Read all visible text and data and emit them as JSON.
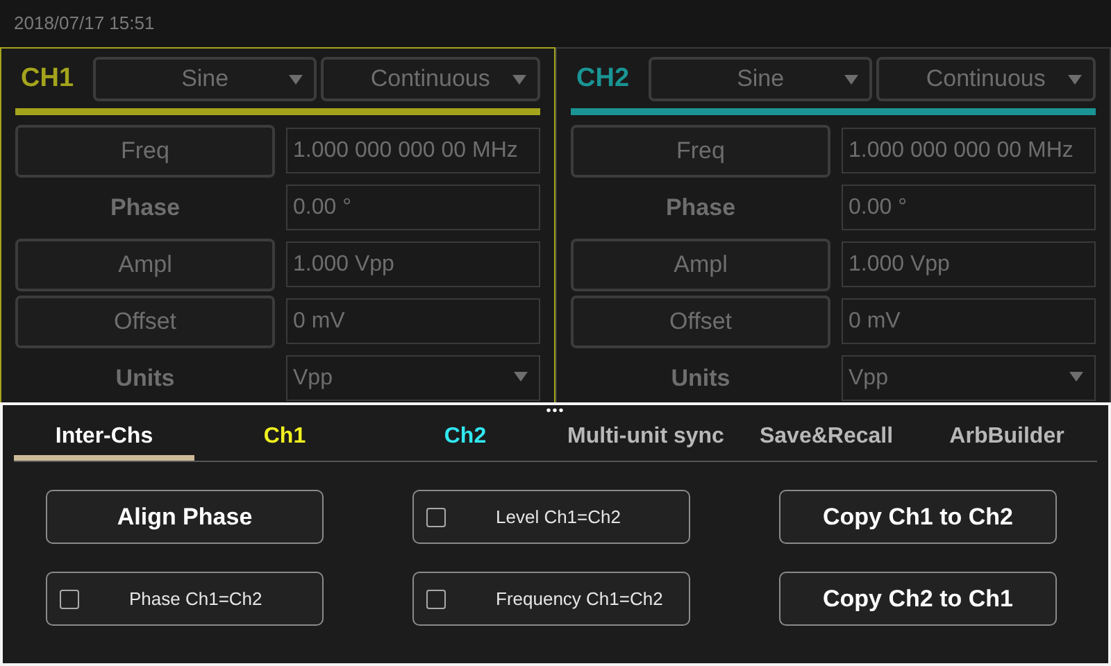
{
  "status_bar": {
    "datetime": "2018/07/17 15:51"
  },
  "channels": [
    {
      "label": "CH1",
      "color": "#a4a41c",
      "selected": true,
      "waveform": "Sine",
      "mode": "Continuous",
      "params": [
        {
          "kind": "button",
          "label": "Freq",
          "value": "1.000 000 000 00 MHz"
        },
        {
          "kind": "label",
          "label": "Phase",
          "value": "0.00 °"
        },
        {
          "kind": "button",
          "label": "Ampl",
          "value": "1.000 Vpp"
        },
        {
          "kind": "button",
          "label": "Offset",
          "value": "0 mV"
        }
      ],
      "units": {
        "label": "Units",
        "value": "Vpp"
      }
    },
    {
      "label": "CH2",
      "color": "#1a9494",
      "selected": false,
      "waveform": "Sine",
      "mode": "Continuous",
      "params": [
        {
          "kind": "button",
          "label": "Freq",
          "value": "1.000 000 000 00 MHz"
        },
        {
          "kind": "label",
          "label": "Phase",
          "value": "0.00 °"
        },
        {
          "kind": "button",
          "label": "Ampl",
          "value": "1.000 Vpp"
        },
        {
          "kind": "button",
          "label": "Offset",
          "value": "0 mV"
        }
      ],
      "units": {
        "label": "Units",
        "value": "Vpp"
      }
    }
  ],
  "panel": {
    "handle": "•••",
    "tabs": [
      {
        "label": "Inter-Chs",
        "selected": true,
        "color": "#ffffff"
      },
      {
        "label": "Ch1",
        "selected": false,
        "color": "#f0f020"
      },
      {
        "label": "Ch2",
        "selected": false,
        "color": "#30e8f0"
      },
      {
        "label": "Multi-unit sync",
        "selected": false,
        "color": "#b8b8b8"
      },
      {
        "label": "Save&Recall",
        "selected": false,
        "color": "#b8b8b8"
      },
      {
        "label": "ArbBuilder",
        "selected": false,
        "color": "#b8b8b8"
      }
    ],
    "controls": [
      {
        "kind": "button",
        "label": "Align Phase"
      },
      {
        "kind": "checkbox",
        "label": "Level Ch1=Ch2",
        "checked": false
      },
      {
        "kind": "button",
        "label": "Copy Ch1 to Ch2"
      },
      {
        "kind": "checkbox",
        "label": "Phase Ch1=Ch2",
        "checked": false
      },
      {
        "kind": "checkbox",
        "label": "Frequency Ch1=Ch2",
        "checked": false
      },
      {
        "kind": "button",
        "label": "Copy Ch2 to Ch1"
      }
    ]
  }
}
